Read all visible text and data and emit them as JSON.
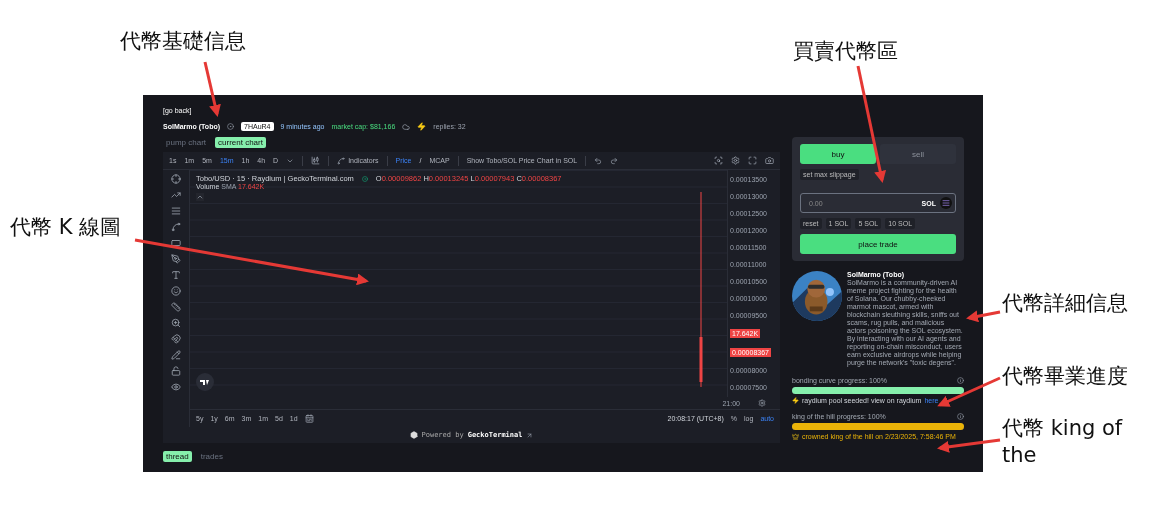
{
  "annotations": [
    {
      "text": "代幣基礎信息"
    },
    {
      "text": "買賣代幣區"
    },
    {
      "text": "代幣 K 線圖"
    },
    {
      "text": "代幣詳細信息"
    },
    {
      "text": "代幣畢業進度"
    },
    {
      "text": "代幣 king of the"
    }
  ],
  "page": {
    "back_link": "[go back]",
    "token": {
      "name": "SolMarmo (Tobo)",
      "address": "7HAuR4",
      "age": "9 minutes ago",
      "market_cap": "market cap: $81,166",
      "replies": "replies: 32"
    },
    "chart_tabs": [
      {
        "label": "pump chart",
        "selected": false
      },
      {
        "label": "current chart",
        "selected": true
      }
    ],
    "chart": {
      "timeframes": [
        {
          "label": "1s",
          "selected": false
        },
        {
          "label": "1m",
          "selected": false
        },
        {
          "label": "5m",
          "selected": false
        },
        {
          "label": "15m",
          "selected": true
        },
        {
          "label": "1h",
          "selected": false
        },
        {
          "label": "4h",
          "selected": false
        },
        {
          "label": "D",
          "selected": false
        }
      ],
      "indicators": "Indicators",
      "price_toggle": [
        {
          "label": "Price",
          "selected": true
        },
        {
          "label": "MCAP",
          "selected": false
        }
      ],
      "separator": "/",
      "sol_toggle": "Show Tobo/SOL Price Chart in SOL",
      "legend": {
        "symbol": "Tobo/USD · 15 · Raydium | GeckoTerminal.com",
        "ohlc": [
          {
            "key": "O",
            "value": "0.00009862"
          },
          {
            "key": "H",
            "value": "0.00013245"
          },
          {
            "key": "L",
            "value": "0.00007943"
          },
          {
            "key": "C",
            "value": "0.00008367"
          }
        ],
        "volume": "Volume",
        "sma": "SMA",
        "volume_value": "17.642K"
      },
      "price_axis": [
        {
          "text": "0.00013500",
          "kind": "tick"
        },
        {
          "text": "0.00013000",
          "kind": "tick"
        },
        {
          "text": "0.00012500",
          "kind": "tick"
        },
        {
          "text": "0.00012000",
          "kind": "tick"
        },
        {
          "text": "0.00011500",
          "kind": "tick"
        },
        {
          "text": "0.00011000",
          "kind": "tick"
        },
        {
          "text": "0.00010500",
          "kind": "tick"
        },
        {
          "text": "0.00010000",
          "kind": "tick"
        },
        {
          "text": "0.00009500",
          "kind": "tick"
        },
        {
          "text": "17.642K",
          "kind": "label"
        },
        {
          "text": "0.00008367",
          "kind": "label"
        },
        {
          "text": "0.00008000",
          "kind": "tick"
        },
        {
          "text": "0.00007500",
          "kind": "tick"
        }
      ],
      "time_tick": "21:00",
      "ranges": [
        "5y",
        "1y",
        "6m",
        "3m",
        "1m",
        "5d",
        "1d"
      ],
      "clock": "20:08:17 (UTC+8)",
      "scale_options": [
        {
          "label": "%",
          "selected": false
        },
        {
          "label": "log",
          "selected": false
        },
        {
          "label": "auto",
          "selected": true
        }
      ],
      "powered_by": "Powered by",
      "powered_brand": "GeckoTerminal"
    },
    "bottom_tabs": [
      {
        "label": "thread",
        "selected": true
      },
      {
        "label": "trades",
        "selected": false
      }
    ],
    "trade": {
      "sides": [
        {
          "label": "buy",
          "selected": true
        },
        {
          "label": "sell",
          "selected": false
        }
      ],
      "slippage": "set max slippage",
      "amount": {
        "placeholder": "0.00",
        "unit": "SOL"
      },
      "quick": [
        "reset",
        "1 SOL",
        "5 SOL",
        "10 SOL"
      ],
      "submit": "place trade"
    },
    "details": {
      "name": "SolMarmo (Tobo)",
      "description": "SolMarmo is a community-driven AI meme project fighting for the health of Solana. Our chubby-cheeked marmot mascot, armed with blockchain sleuthing skills, sniffs out scams, rug pulls, and malicious actors poisoning the SOL ecosystem. By interacting with our AI agents and reporting on-chain misconduct, users earn exclusive airdrops while helping purge the network's \"toxic degens\"."
    },
    "progress": [
      {
        "kind": "bonding",
        "label": "bonding curve progress: 100%",
        "level": 1,
        "color": "#86efac",
        "note": "raydium pool seeded! view on raydium",
        "link": "here"
      },
      {
        "kind": "king",
        "label": "king of the hill progress: 100%",
        "level": 1,
        "color": "#eab308",
        "note": "crowned king of the hill on 2/23/2025, 7:58:46 PM"
      }
    ]
  }
}
